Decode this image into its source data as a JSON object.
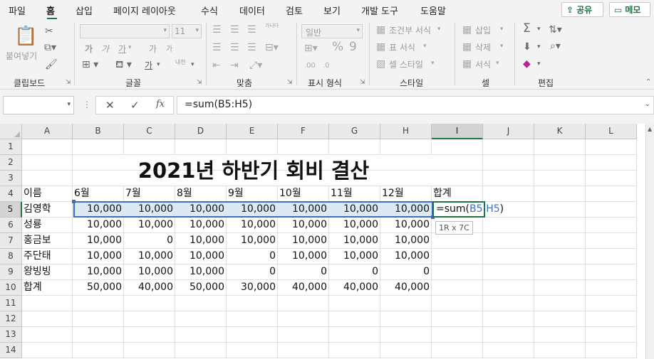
{
  "menu": {
    "items": [
      "파일",
      "홈",
      "삽입",
      "페이지 레이아웃",
      "수식",
      "데이터",
      "검토",
      "보기",
      "개발 도구",
      "도움말"
    ],
    "active": "홈",
    "share_label": "공유",
    "memo_label": "메모"
  },
  "ribbon": {
    "clipboard": {
      "paste_label": "붙여넣기",
      "group_label": "클립보드"
    },
    "font": {
      "size_value": "11",
      "bold": "가",
      "italic": "가",
      "underline": "가",
      "grow": "가",
      "shrink": "가",
      "font_color": "가",
      "phonetic": "내천",
      "group_label": "글꼴"
    },
    "alignment": {
      "group_label": "맞춤",
      "wrap_icon": "가나다"
    },
    "number": {
      "format_value": "일반",
      "group_label": "표시 형식"
    },
    "styles": {
      "conditional": "조건부 서식",
      "table": "표 서식",
      "cell_style": "셀 스타일",
      "group_label": "스타일"
    },
    "cells": {
      "insert": "삽입",
      "delete": "삭제",
      "format": "서식",
      "group_label": "셀"
    },
    "editing": {
      "group_label": "편집"
    }
  },
  "formula_bar": {
    "name_box": "",
    "cancel_icon": "✕",
    "enter_icon": "✓",
    "fx_label": "fx",
    "formula": "=sum(B5:H5)"
  },
  "sheet": {
    "columns": [
      "A",
      "B",
      "C",
      "D",
      "E",
      "F",
      "G",
      "H",
      "I",
      "J",
      "K",
      "L"
    ],
    "selected_column": "I",
    "rows": [
      "1",
      "2",
      "3",
      "4",
      "5",
      "6",
      "7",
      "8",
      "9",
      "10",
      "11",
      "12",
      "13",
      "14"
    ],
    "selected_row": "5",
    "title": "2021년 하반기 회비 결산",
    "header": [
      "이름",
      "6월",
      "7월",
      "8월",
      "9월",
      "10월",
      "11월",
      "12월",
      "합계"
    ],
    "data": [
      {
        "name": "김영학",
        "values": [
          "10,000",
          "10,000",
          "10,000",
          "10,000",
          "10,000",
          "10,000",
          "10,000"
        ]
      },
      {
        "name": "성룡",
        "values": [
          "10,000",
          "10,000",
          "10,000",
          "10,000",
          "10,000",
          "10,000",
          "10,000"
        ]
      },
      {
        "name": "홍금보",
        "values": [
          "10,000",
          "0",
          "10,000",
          "10,000",
          "10,000",
          "10,000",
          "10,000"
        ]
      },
      {
        "name": "주단태",
        "values": [
          "10,000",
          "10,000",
          "10,000",
          "0",
          "10,000",
          "10,000",
          "10,000"
        ]
      },
      {
        "name": "왕빙빙",
        "values": [
          "10,000",
          "10,000",
          "10,000",
          "0",
          "0",
          "0",
          "0"
        ]
      }
    ],
    "total": {
      "name": "합계",
      "values": [
        "50,000",
        "40,000",
        "50,000",
        "30,000",
        "40,000",
        "40,000",
        "40,000"
      ]
    },
    "active_cell": {
      "prefix": "=sum(",
      "ref": "B5:H5",
      "suffix": ")"
    },
    "tooltip": "1R x 7C"
  }
}
